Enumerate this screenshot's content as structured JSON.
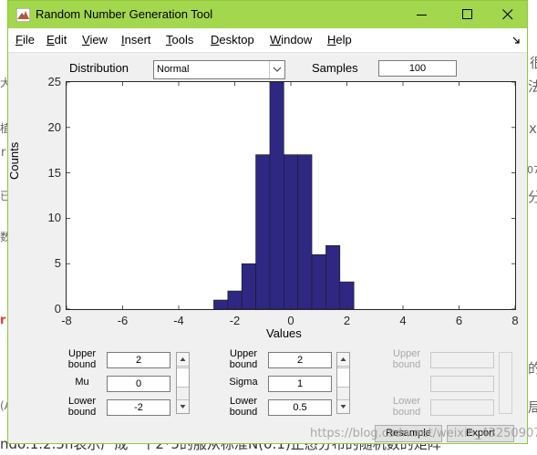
{
  "background": {
    "right_fragments": [
      "很",
      "法",
      "x",
      "07",
      "分",
      "的",
      "局"
    ],
    "left_fragments": [
      "大",
      "植",
      "r",
      "已",
      "数",
      "r",
      "(A"
    ],
    "bottom_line": "ndo.1.2.5n表示产成一个2*5的服从标准N(0.1)正态分布的随机数的矩阵",
    "watermark": "https://blog.csdn.net/weixin_43250907"
  },
  "window": {
    "title": "Random Number Generation Tool",
    "accent_color": "#a2d74e",
    "controls": [
      "minimize-icon",
      "maximize-icon",
      "close-icon"
    ]
  },
  "menu": {
    "items": [
      {
        "label": "File",
        "hotkey": "F",
        "rest": "ile"
      },
      {
        "label": "Edit",
        "hotkey": "E",
        "rest": "dit"
      },
      {
        "label": "View",
        "hotkey": "V",
        "rest": "iew"
      },
      {
        "label": "Insert",
        "hotkey": "I",
        "rest": "nsert"
      },
      {
        "label": "Tools",
        "hotkey": "T",
        "rest": "ools"
      },
      {
        "label": "Desktop",
        "hotkey": "D",
        "rest": "esktop"
      },
      {
        "label": "Window",
        "hotkey": "W",
        "rest": "indow"
      },
      {
        "label": "Help",
        "hotkey": "H",
        "rest": "elp"
      }
    ]
  },
  "controls": {
    "distribution_label": "Distribution",
    "distribution_value": "Normal",
    "samples_label": "Samples",
    "samples_value": "100"
  },
  "chart_data": {
    "type": "bar",
    "title": "",
    "xlabel": "Values",
    "ylabel": "Counts",
    "xlim": [
      -8,
      8
    ],
    "ylim": [
      0,
      25
    ],
    "xticks": [
      "-8",
      "-6",
      "-4",
      "-2",
      "0",
      "2",
      "4",
      "6",
      "8"
    ],
    "yticks": [
      "0",
      "5",
      "10",
      "15",
      "20",
      "25"
    ],
    "bar_color": "#2e2883",
    "bin_width": 0.5,
    "bins": [
      {
        "left": -2.75,
        "count": 1
      },
      {
        "left": -2.25,
        "count": 2
      },
      {
        "left": -1.75,
        "count": 5
      },
      {
        "left": -1.25,
        "count": 17
      },
      {
        "left": -0.75,
        "count": 25
      },
      {
        "left": -0.25,
        "count": 17
      },
      {
        "left": 0.25,
        "count": 17
      },
      {
        "left": 0.75,
        "count": 6
      },
      {
        "left": 1.25,
        "count": 7
      },
      {
        "left": 1.75,
        "count": 3
      }
    ]
  },
  "params": {
    "col1": {
      "upper_label": "Upper bound",
      "upper_value": "2",
      "param_label": "Mu",
      "param_value": "0",
      "lower_label": "Lower bound",
      "lower_value": "-2"
    },
    "col2": {
      "upper_label": "Upper bound",
      "upper_value": "2",
      "param_label": "Sigma",
      "param_value": "1",
      "lower_label": "Lower bound",
      "lower_value": "0.5"
    },
    "col3": {
      "upper_label": "Upper bound",
      "upper_value": "",
      "param_label": "",
      "param_value": "",
      "lower_label": "Lower bound",
      "lower_value": ""
    }
  },
  "buttons": {
    "resample": "Resample",
    "export": "Export"
  }
}
